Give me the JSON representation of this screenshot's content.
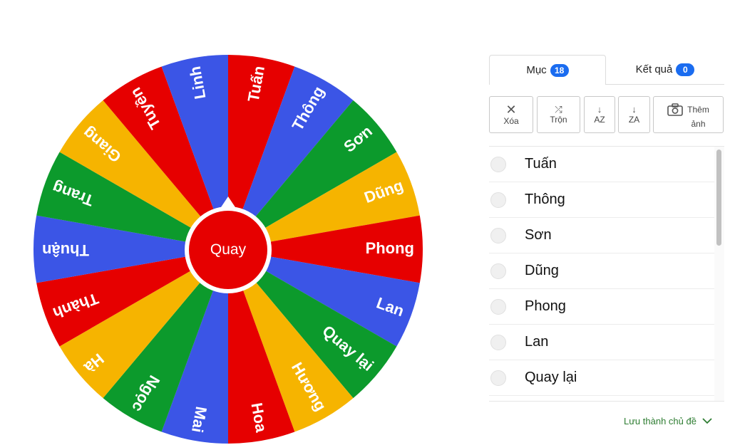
{
  "wheel": {
    "spin_label": "Quay",
    "segments": [
      {
        "label": "Tuấn",
        "color": "#e60000"
      },
      {
        "label": "Thông",
        "color": "#3b55e6"
      },
      {
        "label": "Sơn",
        "color": "#0c9a2c"
      },
      {
        "label": "Dũng",
        "color": "#f6b400"
      },
      {
        "label": "Phong",
        "color": "#e60000"
      },
      {
        "label": "Lan",
        "color": "#3b55e6"
      },
      {
        "label": "Quay lại",
        "color": "#0c9a2c"
      },
      {
        "label": "Hương",
        "color": "#f6b400"
      },
      {
        "label": "Hoa",
        "color": "#e60000"
      },
      {
        "label": "Mai",
        "color": "#3b55e6"
      },
      {
        "label": "Ngọc",
        "color": "#0c9a2c"
      },
      {
        "label": "Hà",
        "color": "#f6b400"
      },
      {
        "label": "Thành",
        "color": "#e60000"
      },
      {
        "label": "Thuận",
        "color": "#3b55e6"
      },
      {
        "label": "Trang",
        "color": "#0c9a2c"
      },
      {
        "label": "Giang",
        "color": "#f6b400"
      },
      {
        "label": "Tuyền",
        "color": "#e60000"
      },
      {
        "label": "Linh",
        "color": "#3b55e6"
      }
    ]
  },
  "tabs": {
    "items_label": "Mục",
    "items_count": "18",
    "results_label": "Kết quả",
    "results_count": "0"
  },
  "toolbar": {
    "clear_label": "Xóa",
    "shuffle_label": "Trộn",
    "sort_az_label": "AZ",
    "sort_za_label": "ZA",
    "add_image_line1": "Thêm",
    "add_image_line2": "ảnh"
  },
  "list": {
    "items": [
      "Tuấn",
      "Thông",
      "Sơn",
      "Dũng",
      "Phong",
      "Lan",
      "Quay lại"
    ]
  },
  "footer": {
    "save_theme_label": "Lưu thành chủ đề"
  },
  "icons": {
    "clear": "close-icon",
    "shuffle": "shuffle-icon",
    "sort_az": "sort-down-icon",
    "sort_za": "sort-down-icon",
    "add_image": "camera-icon",
    "save_theme": "chevron-down-icon"
  }
}
